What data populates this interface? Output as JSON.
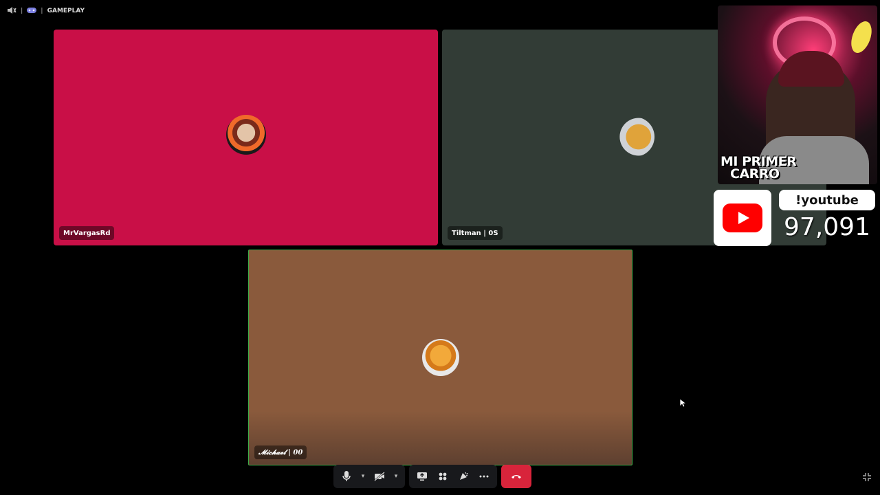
{
  "topbar": {
    "channel": "GAMEPLAY"
  },
  "participants": [
    {
      "name": "MrVargasRd",
      "bg": "#c90f47"
    },
    {
      "name": "Tiltman | 0S",
      "bg": "#323c36"
    },
    {
      "name": "𝓜𝓲𝓬𝓱𝓪𝓮𝓵 | 00",
      "bg": "#8a5a3c"
    }
  ],
  "overlay": {
    "caption_line1": "MI PRIMER",
    "caption_line2": "CARRO",
    "youtube_label": "!youtube",
    "youtube_count": "97,091"
  },
  "colors": {
    "end_call": "#d8243b",
    "active_border": "#3fae4a",
    "youtube_red": "#ff0000"
  },
  "icons": [
    "speaker-icon",
    "gamepad-icon",
    "mic-icon",
    "chevron-down-icon",
    "camera-off-icon",
    "screen-share-icon",
    "activities-icon",
    "soundboard-icon",
    "more-icon",
    "hang-up-icon",
    "fullscreen-exit-icon",
    "youtube-logo-icon"
  ]
}
